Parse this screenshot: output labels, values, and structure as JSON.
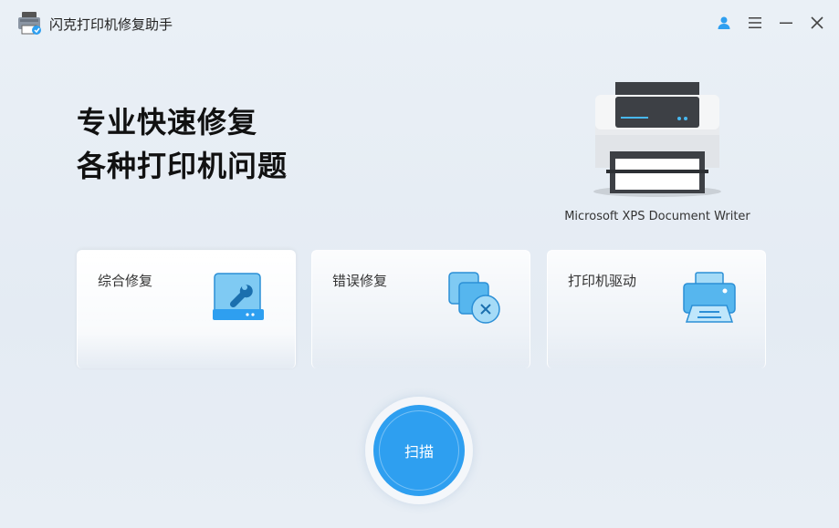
{
  "app": {
    "title": "闪克打印机修复助手"
  },
  "window_controls": {
    "user": "user-icon",
    "menu": "menu-icon",
    "minimize": "minimize-icon",
    "close": "close-icon"
  },
  "hero": {
    "line1": "专业快速修复",
    "line2": "各种打印机问题"
  },
  "printer": {
    "name": "Microsoft XPS Document Writer"
  },
  "cards": [
    {
      "label": "综合修复",
      "icon": "wrench-drive-icon"
    },
    {
      "label": "错误修复",
      "icon": "error-windows-icon"
    },
    {
      "label": "打印机驱动",
      "icon": "printer-icon"
    }
  ],
  "scan": {
    "label": "扫描"
  },
  "colors": {
    "accent": "#2e9ff0",
    "background": "#e6edf4"
  }
}
